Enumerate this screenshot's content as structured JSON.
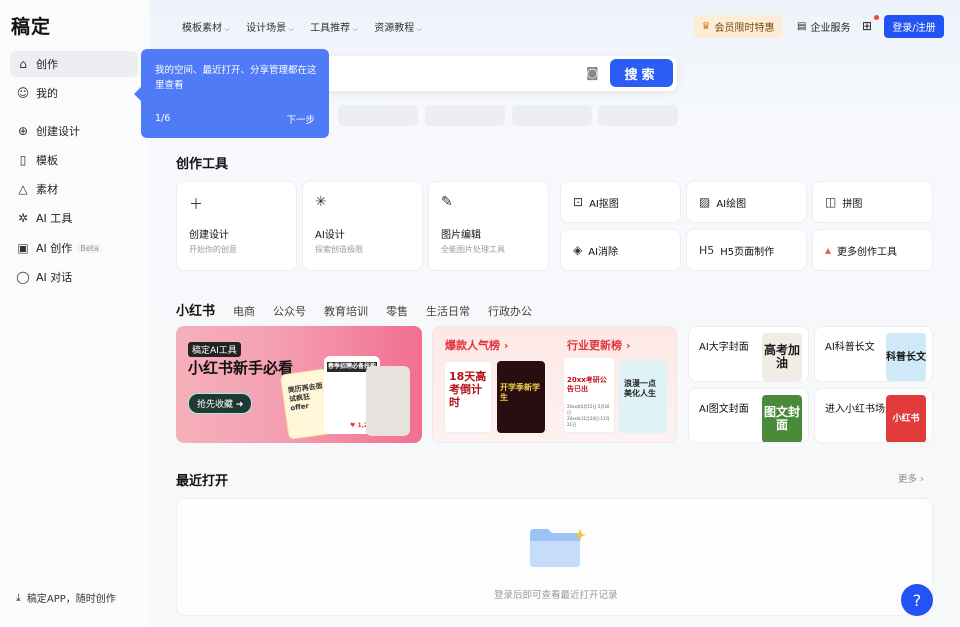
{
  "brand": {
    "logo": "稿定"
  },
  "sidebar": {
    "items": [
      {
        "label": "创作",
        "icon": "home-icon"
      },
      {
        "label": "我的",
        "icon": "user-icon"
      },
      {
        "label": "创建设计",
        "icon": "plus-circle-icon"
      },
      {
        "label": "模板",
        "icon": "template-icon"
      },
      {
        "label": "素材",
        "icon": "shapes-icon"
      },
      {
        "label": "AI 工具",
        "icon": "sparkle-icon"
      },
      {
        "label": "AI 创作",
        "icon": "image-ai-icon",
        "badge": "Beta"
      },
      {
        "label": "AI 对话",
        "icon": "chat-icon"
      }
    ],
    "app_download": "稿定APP，随时创作"
  },
  "topnav": {
    "items": [
      "模板素材",
      "设计场景",
      "工具推荐",
      "资源教程"
    ],
    "vip": "会员限时特惠",
    "enterprise": "企业服务",
    "login": "登录/注册"
  },
  "search": {
    "button": "搜索"
  },
  "tooltip": {
    "text": "我的空间、最近打开、分享管理都在这里查看",
    "step": "1/6",
    "next": "下一步"
  },
  "tools": {
    "title": "创作工具",
    "big": [
      {
        "title": "创建设计",
        "sub": "开始你的创意",
        "icon": "plus-icon"
      },
      {
        "title": "AI设计",
        "sub": "探索创造极限",
        "icon": "sparkle-icon"
      },
      {
        "title": "图片编辑",
        "sub": "全能图片处理工具",
        "icon": "magic-wand-icon"
      }
    ],
    "small": [
      {
        "title": "AI抠图",
        "icon": "cutout-icon"
      },
      {
        "title": "AI绘图",
        "icon": "image-icon"
      },
      {
        "title": "拼图",
        "icon": "collage-icon"
      },
      {
        "title": "AI消除",
        "icon": "eraser-icon"
      },
      {
        "title": "H5页面制作",
        "icon": "h5-icon"
      },
      {
        "title": "更多创作工具",
        "icon": "more-tools-icon"
      }
    ]
  },
  "scenes": {
    "tabs": [
      "小红书",
      "电商",
      "公众号",
      "教育培训",
      "零售",
      "生活日常",
      "行政办公"
    ],
    "banner1": {
      "tag": "稿定AI工具",
      "title": "小红书新手必看",
      "cta": "抢先收藏",
      "card_text_1": "春季招聘必备技能",
      "card_text_2": "简历再去面试疯狂offer",
      "likes": "1,275"
    },
    "banner2": {
      "left_title": "爆款人气榜",
      "right_title": "行业更新榜",
      "thumb1": "18天高考倒计时",
      "thumb2": "开学季新学生",
      "thumb3_title": "20xx考研公告已出",
      "thumb3_dates": "20xx年5月15日-5月16日",
      "thumb3_dates2": "20xx年11月20日-11月21日",
      "thumb4": "浪漫一点美化人生"
    },
    "tiles": [
      {
        "title": "AI大字封面",
        "art": "高考加油"
      },
      {
        "title": "AI科普长文",
        "art": "科普长文"
      },
      {
        "title": "AI图文封面",
        "art": "图文封面"
      },
      {
        "title": "进入小红书场景",
        "art": "小红书"
      }
    ]
  },
  "recent": {
    "title": "最近打开",
    "more": "更多",
    "empty": "登录后即可查看最近打开记录"
  },
  "help": "?"
}
